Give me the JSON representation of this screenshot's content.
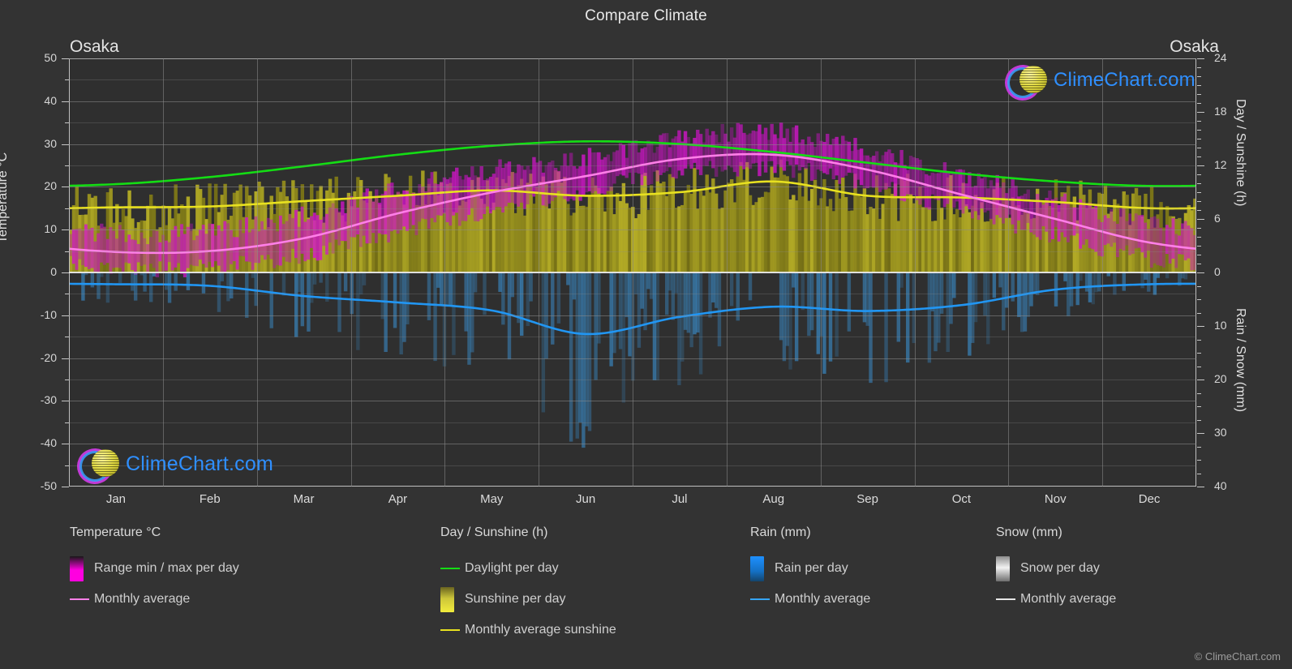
{
  "title": "Compare Climate",
  "city_left": "Osaka",
  "city_right": "Osaka",
  "copyright": "© ClimeChart.com",
  "logo_text": "ClimeChart.com",
  "axes": {
    "left_title": "Temperature °C",
    "right_title_top": "Day / Sunshine (h)",
    "right_title_bottom": "Rain / Snow (mm)",
    "temp_ticks": [
      "50",
      "40",
      "30",
      "20",
      "10",
      "0",
      "-10",
      "-20",
      "-30",
      "-40",
      "-50"
    ],
    "sun_ticks": [
      "24",
      "18",
      "12",
      "6",
      "0"
    ],
    "rain_ticks": [
      "0",
      "10",
      "20",
      "30",
      "40"
    ],
    "months": [
      "Jan",
      "Feb",
      "Mar",
      "Apr",
      "May",
      "Jun",
      "Jul",
      "Aug",
      "Sep",
      "Oct",
      "Nov",
      "Dec"
    ]
  },
  "legend": {
    "groups": [
      {
        "heading": "Temperature °C",
        "items": [
          {
            "label": "Range min / max per day",
            "marker": "box",
            "color": "#ff00e0"
          },
          {
            "label": "Monthly average",
            "marker": "line",
            "color": "#ff7fe8"
          }
        ]
      },
      {
        "heading": "Day / Sunshine (h)",
        "items": [
          {
            "label": "Daylight per day",
            "marker": "line",
            "color": "#14dd14"
          },
          {
            "label": "Sunshine per day",
            "marker": "box",
            "color": "#f2ec3c"
          },
          {
            "label": "Monthly average sunshine",
            "marker": "line",
            "color": "#e8e120"
          }
        ]
      },
      {
        "heading": "Rain (mm)",
        "items": [
          {
            "label": "Rain per day",
            "marker": "box",
            "color": "#1e90ff"
          },
          {
            "label": "Monthly average",
            "marker": "line",
            "color": "#36a5f5"
          }
        ]
      },
      {
        "heading": "Snow (mm)",
        "items": [
          {
            "label": "Snow per day",
            "marker": "box",
            "color": "#e2e2e2"
          },
          {
            "label": "Monthly average",
            "marker": "line",
            "color": "#e6e6e6"
          }
        ]
      }
    ]
  },
  "colors": {
    "background": "#333333",
    "plot_background": "#2f2f2f",
    "grid": "#8d8d8d",
    "daylight": "#14dd14",
    "sunshine_avg": "#e8e120",
    "temp_avg": "#ff7fe8",
    "temp_range": "#cc22cc",
    "rain_avg": "#2196f3",
    "rain_bars": "#1c5f94",
    "text": "#d8d8d8",
    "logo_text": "#2f8fff"
  },
  "chart_data": {
    "type": "line",
    "title": "Compare Climate",
    "subtitle": "Osaka",
    "xlabel": "",
    "ylabel": "Temperature °C",
    "categories": [
      "Jan",
      "Feb",
      "Mar",
      "Apr",
      "May",
      "Jun",
      "Jul",
      "Aug",
      "Sep",
      "Oct",
      "Nov",
      "Dec"
    ],
    "axes": {
      "temperature_C": {
        "min": -50,
        "max": 50,
        "ticks": [
          50,
          40,
          30,
          20,
          10,
          0,
          -10,
          -20,
          -30,
          -40,
          -50
        ],
        "side": "left"
      },
      "day_sunshine_h": {
        "min": 0,
        "max": 24,
        "ticks": [
          24,
          18,
          12,
          6,
          0
        ],
        "side": "right-top"
      },
      "rain_snow_mm": {
        "min": 0,
        "max": 40,
        "ticks": [
          0,
          10,
          20,
          30,
          40
        ],
        "side": "right-bottom",
        "inverted": true
      }
    },
    "grid": true,
    "legend_position": "below",
    "series": [
      {
        "name": "Monthly average temperature",
        "unit": "°C",
        "axis": "temperature_C",
        "color": "#ff7fe8",
        "values": [
          4.8,
          5.0,
          8.0,
          13.8,
          18.7,
          22.5,
          26.5,
          27.5,
          24.0,
          18.2,
          12.5,
          7.0
        ]
      },
      {
        "name": "Daylight per day",
        "unit": "h",
        "axis": "day_sunshine_h",
        "color": "#14dd14",
        "values": [
          9.9,
          10.7,
          11.9,
          13.2,
          14.2,
          14.7,
          14.4,
          13.5,
          12.3,
          11.1,
          10.2,
          9.7
        ]
      },
      {
        "name": "Monthly average sunshine",
        "unit": "h",
        "axis": "day_sunshine_h",
        "color": "#e8e120",
        "values": [
          7.3,
          7.4,
          8.0,
          8.6,
          9.2,
          8.6,
          9.0,
          10.2,
          8.6,
          8.4,
          7.9,
          7.2
        ]
      },
      {
        "name": "Monthly average rain",
        "unit": "mm",
        "axis": "rain_snow_mm",
        "color": "#2196f3",
        "values": [
          2.2,
          2.5,
          4.4,
          5.6,
          7.1,
          11.5,
          8.3,
          6.4,
          7.2,
          6.1,
          3.2,
          2.2
        ]
      },
      {
        "name": "Temperature range min/max per day",
        "unit": "°C",
        "axis": "temperature_C",
        "color": "#cc22cc",
        "min_values": [
          1.0,
          1.2,
          4.0,
          9.2,
          14.3,
          19.0,
          23.4,
          24.3,
          20.8,
          14.5,
          8.6,
          3.3
        ],
        "max_values": [
          9.0,
          9.5,
          13.2,
          19.5,
          24.0,
          26.8,
          31.2,
          33.0,
          28.6,
          22.8,
          17.0,
          11.3
        ]
      },
      {
        "name": "Sunshine per day",
        "unit": "h",
        "axis": "day_sunshine_h",
        "color": "#b5ae25",
        "values": [
          7.3,
          7.4,
          8.0,
          8.6,
          9.2,
          8.6,
          9.0,
          10.2,
          8.6,
          8.4,
          7.9,
          7.2
        ]
      },
      {
        "name": "Rain per day",
        "unit": "mm",
        "axis": "rain_snow_mm",
        "color": "#1c5f94",
        "values": [
          2.2,
          2.5,
          4.4,
          5.6,
          7.1,
          11.5,
          8.3,
          6.4,
          7.2,
          6.1,
          3.2,
          2.2
        ]
      }
    ]
  }
}
